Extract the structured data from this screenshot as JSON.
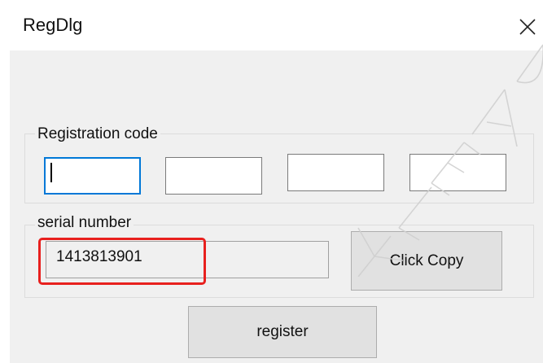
{
  "window": {
    "title": "RegDlg",
    "close_glyph": "✕"
  },
  "registration": {
    "group_label": "Registration code",
    "fields": [
      {
        "value": "",
        "placeholder": ""
      },
      {
        "value": "",
        "placeholder": ""
      },
      {
        "value": "",
        "placeholder": ""
      },
      {
        "value": "",
        "placeholder": ""
      }
    ]
  },
  "serial": {
    "group_label": "serial number",
    "value": "1413813901",
    "copy_button_label": "Click Copy"
  },
  "actions": {
    "register_label": "register"
  },
  "colors": {
    "focus_border": "#0078d7",
    "highlight": "#e8201e",
    "dialog_bg": "#f0f0f0",
    "button_bg": "#e1e1e1"
  },
  "icons": {
    "close": "close-icon"
  }
}
